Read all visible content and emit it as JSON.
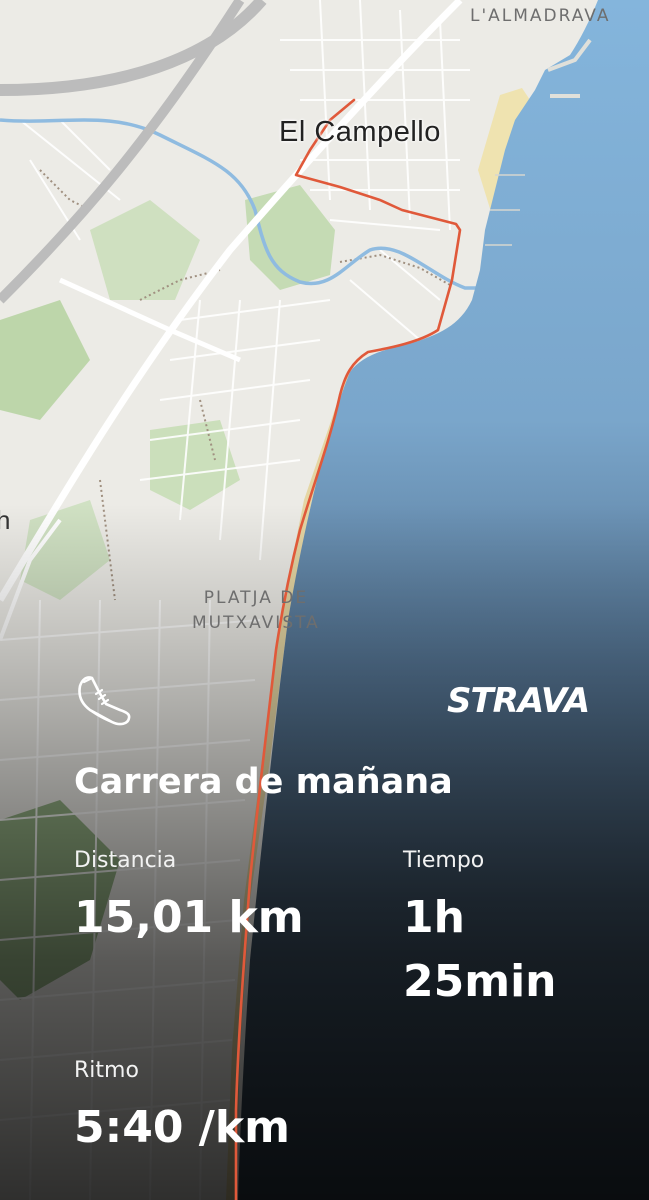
{
  "map": {
    "places": {
      "almadrava": "L'ALMADRAVA",
      "town": "El Campello",
      "beach_line1": "PLATJA DE",
      "beach_line2": "MUTXAVISTA",
      "edge_fragment": "h"
    },
    "colors": {
      "land": "#ecebe6",
      "sea_top": "#86b6dd",
      "sea_bottom": "#2f4050",
      "route": "#e0593a",
      "park": "#b8d4a6"
    }
  },
  "card": {
    "activity_icon": "running-shoe-icon",
    "brand": "STRAVA",
    "title": "Carrera de mañana",
    "stats": {
      "distance_label": "Distancia",
      "distance_value": "15,01 km",
      "time_label": "Tiempo",
      "time_value": "1h 25min",
      "pace_label": "Ritmo",
      "pace_value": "5:40 /km"
    }
  }
}
